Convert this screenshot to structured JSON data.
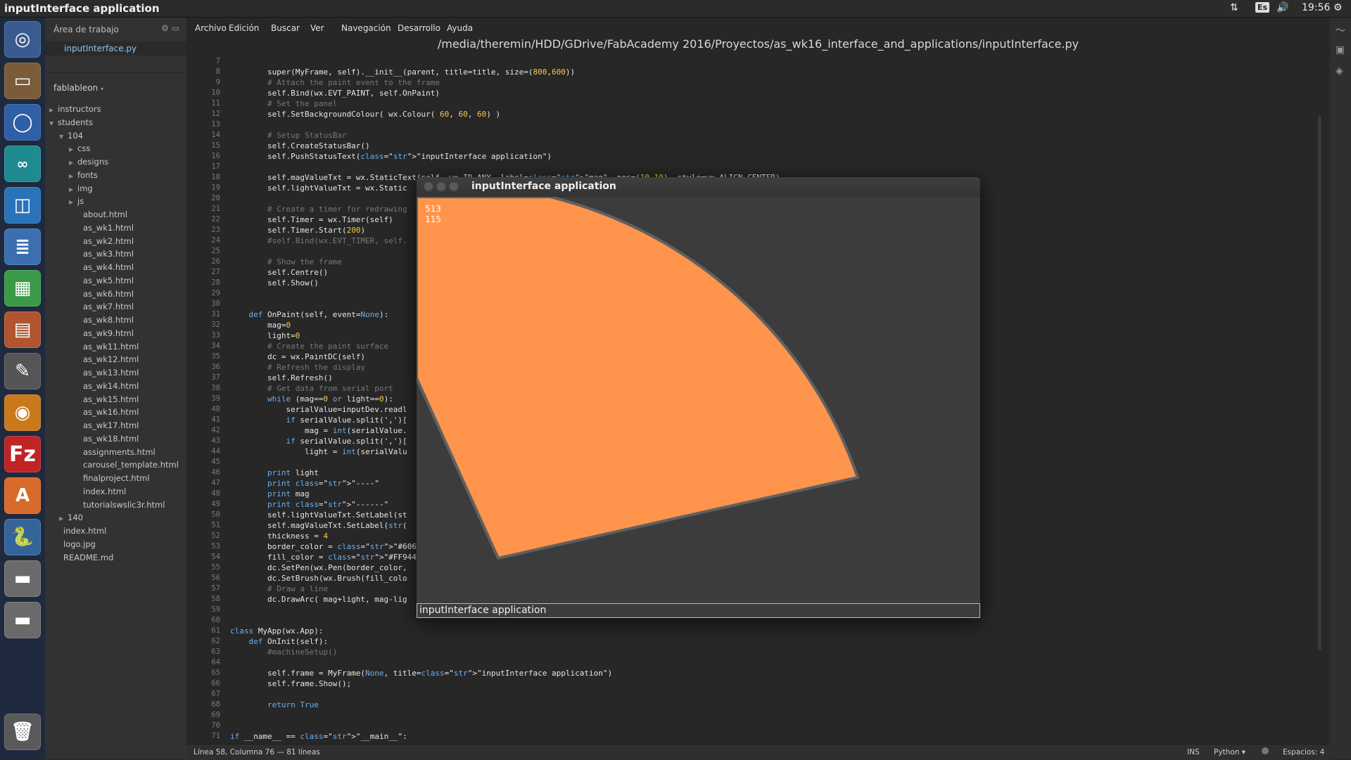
{
  "topbar": {
    "title": "inputInterface application",
    "keyboard": "Es",
    "time": "19:56"
  },
  "sidebar": {
    "header": "Área de trabajo",
    "open_file": "inputInterface.py",
    "project": "fablableon",
    "tree": [
      {
        "label": "instructors",
        "depth": 0,
        "type": "folder",
        "open": false
      },
      {
        "label": "students",
        "depth": 0,
        "type": "folder",
        "open": true
      },
      {
        "label": "104",
        "depth": 1,
        "type": "folder",
        "open": true
      },
      {
        "label": "css",
        "depth": 2,
        "type": "folder",
        "open": false
      },
      {
        "label": "designs",
        "depth": 2,
        "type": "folder",
        "open": false
      },
      {
        "label": "fonts",
        "depth": 2,
        "type": "folder",
        "open": false
      },
      {
        "label": "img",
        "depth": 2,
        "type": "folder",
        "open": false
      },
      {
        "label": "js",
        "depth": 2,
        "type": "folder",
        "open": false
      },
      {
        "label": "about.html",
        "depth": 2,
        "type": "file"
      },
      {
        "label": "as_wk1.html",
        "depth": 2,
        "type": "file"
      },
      {
        "label": "as_wk2.html",
        "depth": 2,
        "type": "file"
      },
      {
        "label": "as_wk3.html",
        "depth": 2,
        "type": "file"
      },
      {
        "label": "as_wk4.html",
        "depth": 2,
        "type": "file"
      },
      {
        "label": "as_wk5.html",
        "depth": 2,
        "type": "file"
      },
      {
        "label": "as_wk6.html",
        "depth": 2,
        "type": "file"
      },
      {
        "label": "as_wk7.html",
        "depth": 2,
        "type": "file"
      },
      {
        "label": "as_wk8.html",
        "depth": 2,
        "type": "file"
      },
      {
        "label": "as_wk9.html",
        "depth": 2,
        "type": "file"
      },
      {
        "label": "as_wk11.html",
        "depth": 2,
        "type": "file"
      },
      {
        "label": "as_wk12.html",
        "depth": 2,
        "type": "file"
      },
      {
        "label": "as_wk13.html",
        "depth": 2,
        "type": "file"
      },
      {
        "label": "as_wk14.html",
        "depth": 2,
        "type": "file"
      },
      {
        "label": "as_wk15.html",
        "depth": 2,
        "type": "file"
      },
      {
        "label": "as_wk16.html",
        "depth": 2,
        "type": "file"
      },
      {
        "label": "as_wk17.html",
        "depth": 2,
        "type": "file"
      },
      {
        "label": "as_wk18.html",
        "depth": 2,
        "type": "file"
      },
      {
        "label": "assignments.html",
        "depth": 2,
        "type": "file"
      },
      {
        "label": "carousel_template.html",
        "depth": 2,
        "type": "file"
      },
      {
        "label": "finalproject.html",
        "depth": 2,
        "type": "file"
      },
      {
        "label": "index.html",
        "depth": 2,
        "type": "file"
      },
      {
        "label": "tutorialswslic3r.html",
        "depth": 2,
        "type": "file"
      },
      {
        "label": "140",
        "depth": 1,
        "type": "folder",
        "open": false
      },
      {
        "label": "index.html",
        "depth": 0,
        "type": "file"
      },
      {
        "label": "logo.jpg",
        "depth": 0,
        "type": "file"
      },
      {
        "label": "README.md",
        "depth": 0,
        "type": "file"
      }
    ]
  },
  "menu": [
    "Archivo",
    "Edición",
    "Buscar",
    "Ver",
    "Navegación",
    "Desarrollo",
    "Ayuda"
  ],
  "editor": {
    "filepath": "/media/theremin/HDD/GDrive/FabAcademy 2016/Proyectos/as_wk16_interface_and_applications/inputInterface.py",
    "line_numbers": [
      "7",
      "8",
      "9",
      "10",
      "11",
      "12",
      "13",
      "14",
      "15",
      "16",
      "17",
      "18",
      "19",
      "20",
      "21",
      "22",
      "23",
      "24",
      "25",
      "26",
      "27",
      "28",
      "29",
      "30",
      "31",
      "32",
      "33",
      "34",
      "35",
      "36",
      "37",
      "38",
      "39",
      "40",
      "41",
      "42",
      "43",
      "44",
      "45",
      "46",
      "47",
      "48",
      "49",
      "50",
      "51",
      "52",
      "53",
      "54",
      "55",
      "56",
      "57",
      "58",
      "59",
      "60",
      "61",
      "62",
      "63",
      "64",
      "65",
      "66",
      "67",
      "68",
      "69",
      "70",
      "71"
    ],
    "code_lines": [
      "",
      "        super(MyFrame, self).__init__(parent, title=title, size=(800,600))",
      "        # Attach the paint event to the frame",
      "        self.Bind(wx.EVT_PAINT, self.OnPaint)",
      "        # Set the panel",
      "        self.SetBackgroundColour( wx.Colour( 60, 60, 60) )",
      "",
      "        # Setup StatusBar",
      "        self.CreateStatusBar()",
      "        self.PushStatusText(\"inputInterface application\")",
      "",
      "        self.magValueTxt = wx.StaticText(self, wx.ID_ANY, label=\"mag\", pos=(10,10), style=wx.ALIGN_CENTER)",
      "        self.lightValueTxt = wx.Static",
      "",
      "        # Create a timer for redrawing",
      "        self.Timer = wx.Timer(self)",
      "        self.Timer.Start(200)",
      "        #self.Bind(wx.EVT_TIMER, self.",
      "",
      "        # Show the frame",
      "        self.Centre()",
      "        self.Show()",
      "",
      "",
      "    def OnPaint(self, event=None):",
      "        mag=0",
      "        light=0",
      "        # Create the paint surface",
      "        dc = wx.PaintDC(self)",
      "        # Refresh the display",
      "        self.Refresh()",
      "        # Get data from serial port",
      "        while (mag==0 or light==0):",
      "            serialValue=inputDev.readl",
      "            if serialValue.split(',')[",
      "                mag = int(serialValue.",
      "            if serialValue.split(',')[",
      "                light = int(serialValu",
      "",
      "        print light",
      "        print \"----\"",
      "        print mag",
      "        print \"------\"",
      "        self.lightValueTxt.SetLabel(st",
      "        self.magValueTxt.SetLabel(str(",
      "        thickness = 4",
      "        border_color = \"#606060\"",
      "        fill_color = \"#FF944D\"",
      "        dc.SetPen(wx.Pen(border_color,",
      "        dc.SetBrush(wx.Brush(fill_colo",
      "        # Draw a line",
      "        dc.DrawArc( mag+light, mag-lig",
      "",
      "",
      "class MyApp(wx.App):",
      "    def OnInit(self):",
      "        #machineSetup()",
      "",
      "        self.frame = MyFrame(None, title=\"inputInterface application\")",
      "        self.frame.Show();",
      "",
      "        return True",
      "",
      "",
      "if __name__ == \"__main__\":"
    ]
  },
  "statusbar": {
    "position": "Línea 58, Columna 76 — 81 líneas",
    "mode": "INS",
    "language": "Python ▾",
    "spaces": "Espacios: 4"
  },
  "app_window": {
    "title": "inputInterface application",
    "mag_value": "513",
    "light_value": "115",
    "status_text": "inputInterface application",
    "fill_color": "#FF944D",
    "border_color": "#606060"
  },
  "launcher_icons": [
    "ubuntu-dash-icon",
    "files-icon",
    "chromium-icon",
    "arduino-icon",
    "fritzing-icon",
    "writer-icon",
    "calc-icon",
    "impress-icon",
    "system-settings-icon",
    "audio-app-icon",
    "filezilla-icon",
    "software-center-icon",
    "python-icon",
    "drive-icon",
    "drive-icon-2",
    "trash-icon"
  ]
}
